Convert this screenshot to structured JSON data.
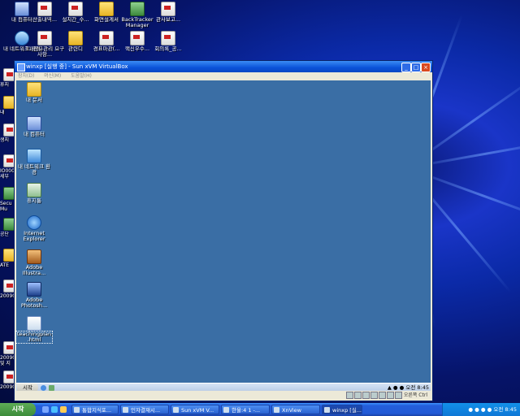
{
  "host_desktop": {
    "top_row": [
      {
        "label": "내 컴퓨터",
        "icon": "computer-icon"
      },
      {
        "label": "산출내역...",
        "icon": "document-icon"
      },
      {
        "label": "설치간_수...",
        "icon": "document-icon"
      },
      {
        "label": "화면설계서",
        "icon": "folder-icon"
      },
      {
        "label": "BackTracker Manager",
        "icon": "app-icon"
      },
      {
        "label": "관사보고...",
        "icon": "document-icon"
      }
    ],
    "second_row": [
      {
        "label": "내 네트워크 환경",
        "icon": "network-icon"
      },
      {
        "label": "11.정규관리 요구사항...",
        "icon": "document-icon"
      },
      {
        "label": "관련디",
        "icon": "folder-icon"
      },
      {
        "label": "경표마관(...",
        "icon": "document-icon"
      },
      {
        "label": "핵신우수...",
        "icon": "document-icon"
      },
      {
        "label": "회의록_공...",
        "icon": "document-icon"
      }
    ],
    "left_edge": [
      "휴지",
      "내",
      "생지",
      "IO000 세부",
      "Secu Mu",
      "공단",
      "ATE",
      "20090",
      "20090 및 지",
      "20090"
    ]
  },
  "vbox_window": {
    "title": "winxp [실행 중] - Sun xVM VirtualBox",
    "menu": [
      "장치(D)",
      "머신(M)",
      "도움말(H)"
    ],
    "guest_icons": [
      {
        "label": "내 문서",
        "icon": "folder-icon"
      },
      {
        "label": "내 컴퓨터",
        "icon": "computer-icon"
      },
      {
        "label": "내 네트워크 환경",
        "icon": "network-icon"
      },
      {
        "label": "휴지통",
        "icon": "trash-icon"
      },
      {
        "label": "Internet Explorer",
        "icon": "ie-icon"
      },
      {
        "label": "Adobe Illustra...",
        "icon": "illustrator-icon"
      },
      {
        "label": "Adobe Photosh...",
        "icon": "photoshop-icon"
      },
      {
        "label": "teachingplan .html",
        "icon": "html-icon"
      }
    ],
    "guest_taskbar": {
      "start_label": "시작",
      "tray_time": "오전 8:45"
    },
    "status_right": "오른쪽 Ctrl"
  },
  "host_taskbar": {
    "start_label": "시작",
    "tasks": [
      "통합지식포...",
      "인자결재시...",
      "Sun xVM V...",
      "한울:4 1 -...",
      "XnView",
      "winxp [실..."
    ],
    "tray_time": "오전 8:45"
  },
  "colors": {
    "guest_background": "#3a6ea5",
    "title_bar": "#0a52d8",
    "host_taskbar": "#245edb",
    "start_green": "#3c8c3a"
  }
}
